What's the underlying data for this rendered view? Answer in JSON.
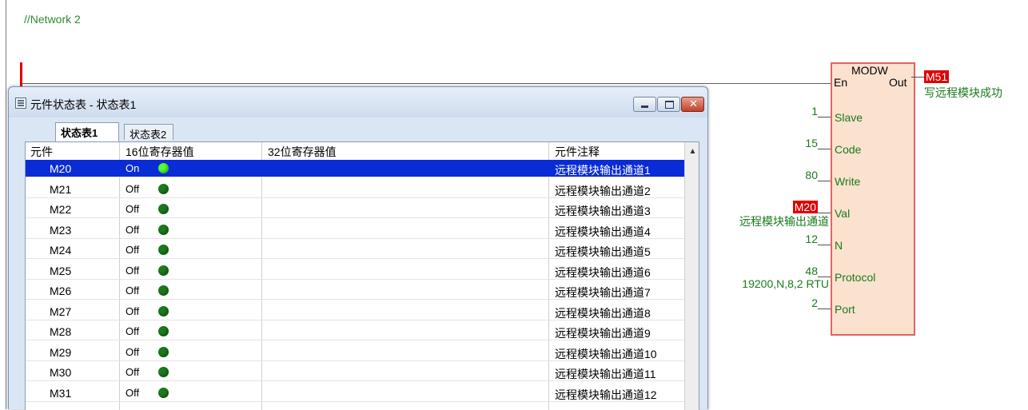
{
  "network": {
    "title": "//Network 2"
  },
  "function_block": {
    "name": "MODW",
    "en_label": "En",
    "out_label": "Out",
    "output_coil": "M51",
    "output_comment": "写远程模块成功",
    "pins": [
      {
        "label": "Slave",
        "value": "1",
        "highlight": false,
        "comment": ""
      },
      {
        "label": "Code",
        "value": "15",
        "highlight": false,
        "comment": ""
      },
      {
        "label": "Write",
        "value": "80",
        "highlight": false,
        "comment": ""
      },
      {
        "label": "Val",
        "value": "M20",
        "highlight": true,
        "comment": "远程模块输出通道"
      },
      {
        "label": "N",
        "value": "12",
        "highlight": false,
        "comment": ""
      },
      {
        "label": "Protocol",
        "value": "48",
        "highlight": false,
        "comment": "19200,N,8,2 RTU"
      },
      {
        "label": "Port",
        "value": "2",
        "highlight": false,
        "comment": ""
      }
    ]
  },
  "status_window": {
    "title": "元件状态表 - 状态表1",
    "tabs": [
      "状态表1",
      "状态表2"
    ],
    "active_tab": 0,
    "columns": [
      "元件",
      "16位寄存器值",
      "32位寄存器值",
      "元件注释"
    ],
    "rows": [
      {
        "name": "M20",
        "state": "On",
        "comment": "远程模块输出通道1",
        "selected": true
      },
      {
        "name": "M21",
        "state": "Off",
        "comment": "远程模块输出通道2",
        "selected": false
      },
      {
        "name": "M22",
        "state": "Off",
        "comment": "远程模块输出通道3",
        "selected": false
      },
      {
        "name": "M23",
        "state": "Off",
        "comment": "远程模块输出通道4",
        "selected": false
      },
      {
        "name": "M24",
        "state": "Off",
        "comment": "远程模块输出通道5",
        "selected": false
      },
      {
        "name": "M25",
        "state": "Off",
        "comment": "远程模块输出通道6",
        "selected": false
      },
      {
        "name": "M26",
        "state": "Off",
        "comment": "远程模块输出通道7",
        "selected": false
      },
      {
        "name": "M27",
        "state": "Off",
        "comment": "远程模块输出通道8",
        "selected": false
      },
      {
        "name": "M28",
        "state": "Off",
        "comment": "远程模块输出通道9",
        "selected": false
      },
      {
        "name": "M29",
        "state": "Off",
        "comment": "远程模块输出通道10",
        "selected": false
      },
      {
        "name": "M30",
        "state": "Off",
        "comment": "远程模块输出通道11",
        "selected": false
      },
      {
        "name": "M31",
        "state": "Off",
        "comment": "远程模块输出通道12",
        "selected": false
      }
    ]
  },
  "colors": {
    "selected_row": "#0a2cd6",
    "led_on": "#52ff30",
    "led_off": "#1b7a1b",
    "coil_highlight": "#e00000",
    "comment_text": "#1a7a1a"
  }
}
